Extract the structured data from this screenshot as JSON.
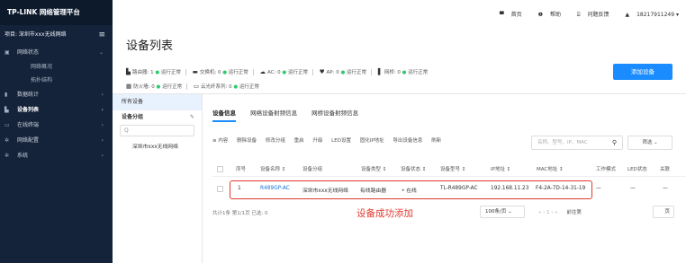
{
  "app": {
    "logo": "TP-LINK 网络管理平台"
  },
  "topbar": {
    "home": "首页",
    "help": "帮助",
    "feedback": "问题反馈",
    "user": "18217911249 ▾"
  },
  "sidebar": {
    "project": "项目: 深圳市xxx无线网络",
    "items": [
      {
        "label": "网络状态",
        "icon": "monitor-icon",
        "chevron": "⌄"
      },
      {
        "label": "网络概况"
      },
      {
        "label": "拓扑结构"
      },
      {
        "label": "数据统计",
        "icon": "bar-chart-icon",
        "chevron": "›"
      },
      {
        "label": "设备列表",
        "icon": "device-icon",
        "chevron": "›"
      },
      {
        "label": "在线终端",
        "icon": "terminal-icon",
        "chevron": "›"
      },
      {
        "label": "网络配置",
        "icon": "gear-icon",
        "chevron": "›"
      },
      {
        "label": "系统",
        "icon": "gear-icon",
        "chevron": "›"
      }
    ]
  },
  "page": {
    "title": "设备列表",
    "add_button": "添加设备"
  },
  "stats": {
    "row1": [
      {
        "label": "路由器: 1",
        "status": "运行正常"
      },
      {
        "label": "交换机: 0",
        "status": "运行正常"
      },
      {
        "label": "AC: 0",
        "status": "运行正常"
      },
      {
        "label": "AP: 0",
        "status": "运行正常"
      },
      {
        "label": "网桥: 0",
        "status": "运行正常"
      }
    ],
    "row2": [
      {
        "label": "防火墙: 0",
        "status": "运行正常"
      },
      {
        "label": "云光纤系列: 0",
        "status": "运行正常"
      }
    ]
  },
  "left_panel": {
    "all": "所有设备",
    "group": "设备分组",
    "search_placeholder": "Q",
    "group_item": "深圳市xxx无线网络"
  },
  "tabs": [
    "设备信息",
    "网络设备射频信息",
    "网桥设备射频信息"
  ],
  "toolbar": [
    "≡ 内容",
    "删除设备",
    "修改分组",
    "重启",
    "升级",
    "LED设置",
    "固化IP地址",
    "导出设备信息",
    "刷新"
  ],
  "filter": {
    "placeholder": "名称、型号、IP、MAC",
    "sift": "筛选 ⌄"
  },
  "table": {
    "headers": [
      "序号",
      "设备名称 ↕",
      "设备分组",
      "设备类型 ↕",
      "设备状态 ↕",
      "设备型号 ↕",
      "IP地址 ↕",
      "MAC地址 ↕",
      "工作模式",
      "LED状态",
      "关联"
    ],
    "row": [
      "1",
      "R489GP-AC",
      "深圳市xxx无线网络",
      "有线路由器",
      "• 在线",
      "TL-R489GP-AC",
      "192.168.11.23",
      "F4-2A-7D-14-31-19",
      "—",
      "—",
      "—"
    ]
  },
  "footer": {
    "summary": "共计1条 第1/1页 已选: 0",
    "success": "设备成功添加",
    "per_page": "100条/页 ⌄",
    "pager": "«  ‹  1  ›  »",
    "goto": "前往第",
    "page": "页"
  },
  "colors": {
    "sidebar": "#15233a",
    "accent": "#1a8cff",
    "highlight": "#e03a2f"
  }
}
